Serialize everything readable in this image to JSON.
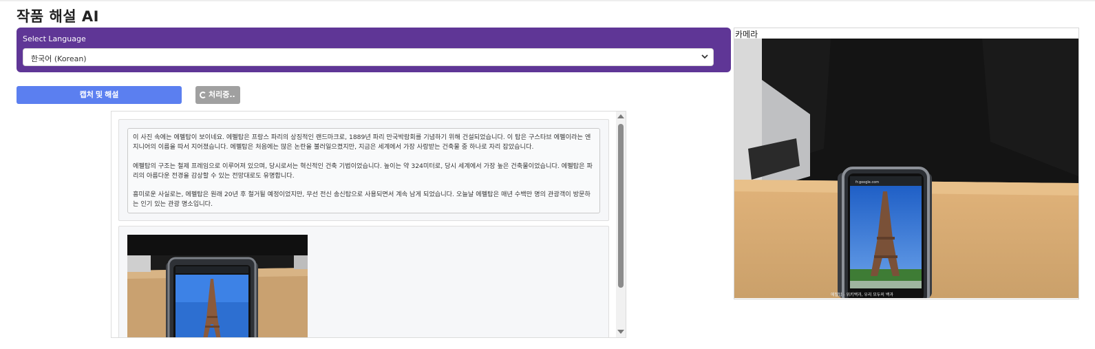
{
  "app": {
    "title": "작품 해설 AI"
  },
  "language": {
    "label": "Select Language",
    "selected": "한국어 (Korean)"
  },
  "actions": {
    "capture_label": "캡처 및 해설",
    "processing_label": "처리중.."
  },
  "results": {
    "paragraphs": [
      "이 사진 속에는 에펠탑이 보이네요. 에펠탑은 프랑스 파리의 상징적인 랜드마크로, 1889년 파리 만국박람회를 기념하기 위해 건설되었습니다. 이 탑은 구스타브 에펠이라는 엔지니어의 이름을 따서 지어졌습니다. 에펠탑은 처음에는 많은 논란을 불러일으켰지만, 지금은 세계에서 가장 사랑받는 건축물 중 하나로 자리 잡았습니다.",
      "에펠탑의 구조는 철제 프레임으로 이루어져 있으며, 당시로서는 혁신적인 건축 기법이었습니다. 높이는 약 324미터로, 당시 세계에서 가장 높은 건축물이었습니다. 에펠탑은 파리의 아름다운 전경을 감상할 수 있는 전망대로도 유명합니다.",
      "흥미로운 사실로는, 에펠탑은 원래 20년 후 철거될 예정이었지만, 무선 전신 송신탑으로 사용되면서 계속 남게 되었습니다. 오늘날 에펠탑은 매년 수백만 명의 관광객이 방문하는 인기 있는 관광 명소입니다."
    ]
  },
  "camera": {
    "label": "카메라",
    "phone_url": "fr.google.com",
    "caption": "에펠탑 - 위키백과, 우리 모두의 백과"
  },
  "colors": {
    "panel_purple": "#5f3696",
    "capture_blue": "#5b7ff0",
    "processing_gray": "#a0a0a0"
  },
  "icons": {
    "select": "chevron-down-icon",
    "spinner": "spinner-icon",
    "scroll_up": "scroll-up-arrow-icon",
    "scroll_down": "scroll-down-arrow-icon"
  }
}
